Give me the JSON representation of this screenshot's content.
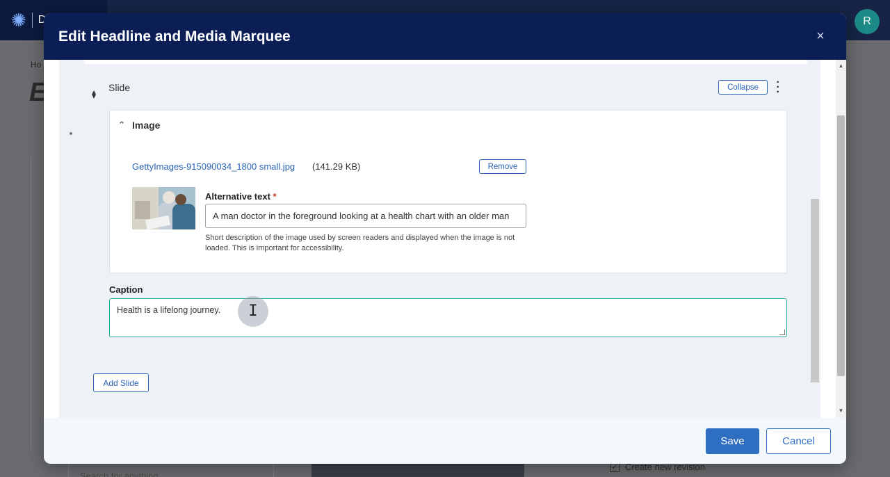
{
  "background": {
    "logo_letter": "D",
    "avatar_initial": "R",
    "breadcrumb": "Ho",
    "big_title": "E",
    "search_placeholder": "Search for anything",
    "create_revision_label": "Create new revision"
  },
  "modal": {
    "title": "Edit Headline and Media Marquee",
    "close_glyph": "×"
  },
  "slide": {
    "label": "Slide",
    "collapse_label": "Collapse",
    "image_section": {
      "title": "Image",
      "file_name": "GettyImages-915090034_1800 small.jpg",
      "file_size": "(141.29 KB)",
      "remove_label": "Remove",
      "alt_text_label": "Alternative text",
      "alt_text_required_mark": "*",
      "alt_text_value": "A man doctor in the foreground looking at a health chart with an older man",
      "alt_text_help": "Short description of the image used by screen readers and displayed when the image is not loaded. This is important for accessibility."
    },
    "caption": {
      "label": "Caption",
      "value": "Health is a lifelong journey."
    }
  },
  "add_slide_label": "Add Slide",
  "footer": {
    "save_label": "Save",
    "cancel_label": "Cancel"
  },
  "icons": {
    "logo": "brand-burst-icon",
    "drag": "drag-handle-icon",
    "collapse": "chevron-up-icon",
    "more": "kebab-menu-icon",
    "close": "close-icon",
    "cursor": "text-cursor-icon"
  },
  "colors": {
    "header_bg": "#0b1e55",
    "primary": "#2f6fc2",
    "link": "#2b63b5",
    "caption_focus": "#2aa79b",
    "required": "#c0392b"
  }
}
